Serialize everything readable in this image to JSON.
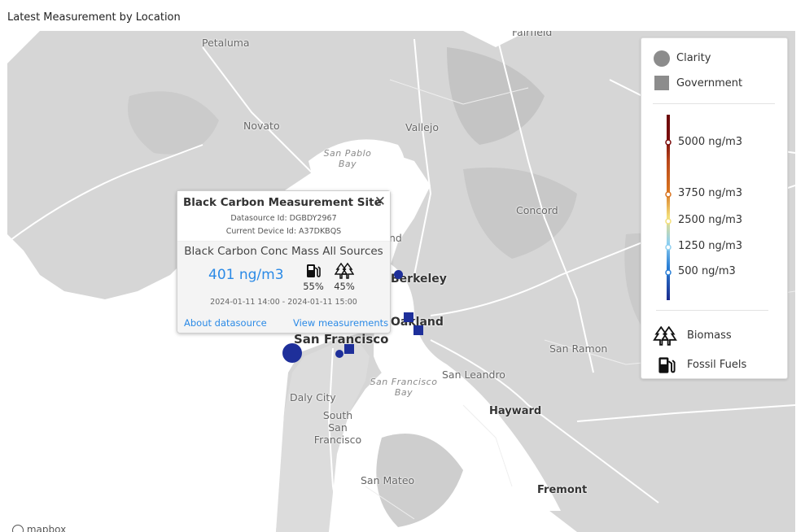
{
  "page": {
    "title": "Latest Measurement by Location"
  },
  "map": {
    "places": [
      {
        "key": "petaluma",
        "label": "Petaluma"
      },
      {
        "key": "fairfield",
        "label": "Fairfield"
      },
      {
        "key": "novato",
        "label": "Novato"
      },
      {
        "key": "vallejo",
        "label": "Vallejo"
      },
      {
        "key": "concord",
        "label": "Concord"
      },
      {
        "key": "berkeley",
        "label": "Berkeley"
      },
      {
        "key": "oakland",
        "label": "Oakland"
      },
      {
        "key": "san_francisco",
        "label": "San Francisco"
      },
      {
        "key": "san_ramon",
        "label": "San Ramon"
      },
      {
        "key": "san_leandro",
        "label": "San Leandro"
      },
      {
        "key": "daly_city",
        "label": "Daly City"
      },
      {
        "key": "south_sf",
        "label": "South San Francisco"
      },
      {
        "key": "hayward",
        "label": "Hayward"
      },
      {
        "key": "san_mateo",
        "label": "San Mateo"
      },
      {
        "key": "fremont",
        "label": "Fremont"
      },
      {
        "key": "richmond_partial",
        "label": "nd"
      }
    ],
    "water_labels": [
      {
        "key": "san_pablo_bay",
        "line1": "San Pablo",
        "line2": "Bay"
      },
      {
        "key": "sf_bay",
        "line1": "San Francisco",
        "line2": "Bay"
      }
    ],
    "marker_color": "#1e2f9a",
    "attribution": "mapbox"
  },
  "popup": {
    "title": "Black Carbon Measurement Site",
    "close_icon": "close-icon",
    "datasource_id": "Datasource Id: DGBDY2967",
    "device_id": "Current Device Id: A37DKBQS",
    "parameter": "Black Carbon Conc Mass All Sources",
    "value": "401 ng/m3",
    "value_color": "#2b8ae6",
    "fossil_fuels_pct": "55%",
    "biomass_pct": "45%",
    "fossil_icon": "fuel-pump-icon",
    "biomass_icon": "trees-icon",
    "time_range": "2024-01-11 14:00 - 2024-01-11 15:00",
    "about_link": "About datasource",
    "view_link": "View measurements"
  },
  "legend": {
    "source_types": [
      {
        "key": "clarity",
        "label": "Clarity",
        "shape": "circle"
      },
      {
        "key": "government",
        "label": "Government",
        "shape": "square"
      }
    ],
    "scale": [
      {
        "label": "5000 ng/m3",
        "color": "#7a0c0c"
      },
      {
        "label": "3750 ng/m3",
        "color": "#d8731f"
      },
      {
        "label": "2500 ng/m3",
        "color": "#f3df7a"
      },
      {
        "label": "1250 ng/m3",
        "color": "#8fd0f0"
      },
      {
        "label": "500 ng/m3",
        "color": "#2a7fd6"
      }
    ],
    "scale_bottom_color": "#1a2a8c",
    "source_apportionment": [
      {
        "key": "biomass",
        "label": "Biomass",
        "icon": "trees-icon"
      },
      {
        "key": "fossil",
        "label": "Fossil Fuels",
        "icon": "fuel-pump-icon"
      }
    ]
  }
}
